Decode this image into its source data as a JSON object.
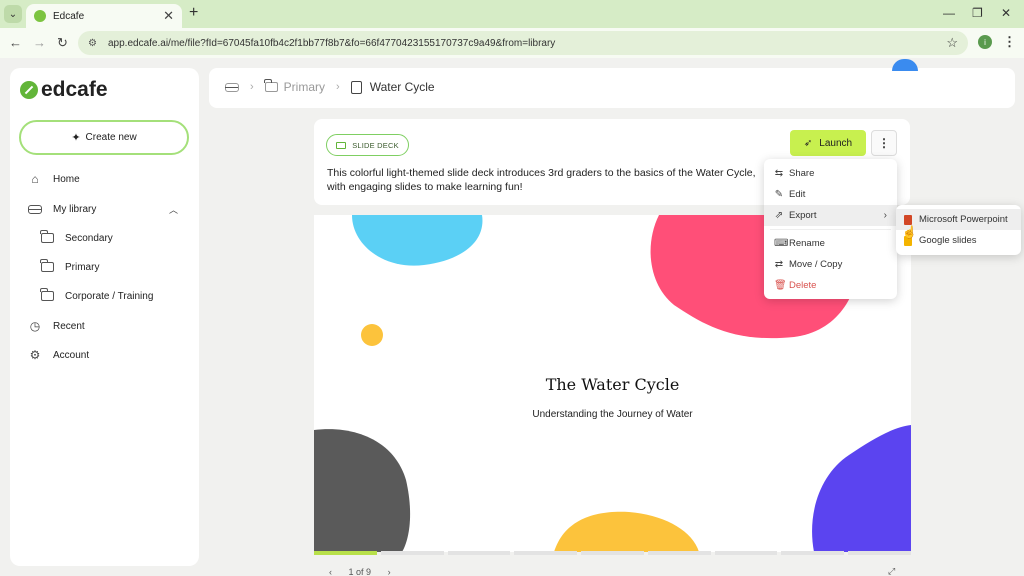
{
  "browser": {
    "tab_title": "Edcafe",
    "tab_close": "✕",
    "new_tab": "+",
    "url": "app.edcafe.ai/me/file?fId=67045fa10fb4c2f1bb77f8b7&fo=66f4770423155170737c9a49&from=library",
    "profile_initial": "i"
  },
  "sidebar": {
    "logo": "edcafe",
    "create_label": "Create new",
    "items": [
      {
        "label": "Home",
        "icon": "home-icon"
      },
      {
        "label": "My library",
        "icon": "library-icon"
      },
      {
        "label": "Secondary",
        "icon": "folder-icon"
      },
      {
        "label": "Primary",
        "icon": "folder-icon"
      },
      {
        "label": "Corporate / Training",
        "icon": "folder-icon"
      },
      {
        "label": "Recent",
        "icon": "clock-icon"
      },
      {
        "label": "Account",
        "icon": "gear-icon"
      }
    ]
  },
  "breadcrumb": {
    "folder": "Primary",
    "current": "Water Cycle"
  },
  "deck": {
    "badge": "SLIDE DECK",
    "launch_label": "Launch",
    "description": "This colorful light-themed slide deck introduces 3rd graders to the basics of the Water Cycle, with engaging slides to make learning fun!",
    "slide_title": "The Water Cycle",
    "slide_subtitle": "Understanding the Journey of Water",
    "pager": "1 of 9",
    "total_slides": 9,
    "current_slide": 1
  },
  "menu": {
    "share": "Share",
    "edit": "Edit",
    "export": "Export",
    "rename": "Rename",
    "move_copy": "Move / Copy",
    "delete": "Delete"
  },
  "export_submenu": {
    "powerpoint": "Microsoft Powerpoint",
    "google_slides": "Google slides"
  },
  "colors": {
    "accent": "#c8f04f",
    "brand": "#62b539",
    "blob_blue": "#5bd0f5",
    "blob_pink": "#ff4f78",
    "blob_yellow": "#fcc33c",
    "blob_gray": "#5a5a5a",
    "blob_purple": "#5b44f0",
    "delete": "#d9534f"
  }
}
